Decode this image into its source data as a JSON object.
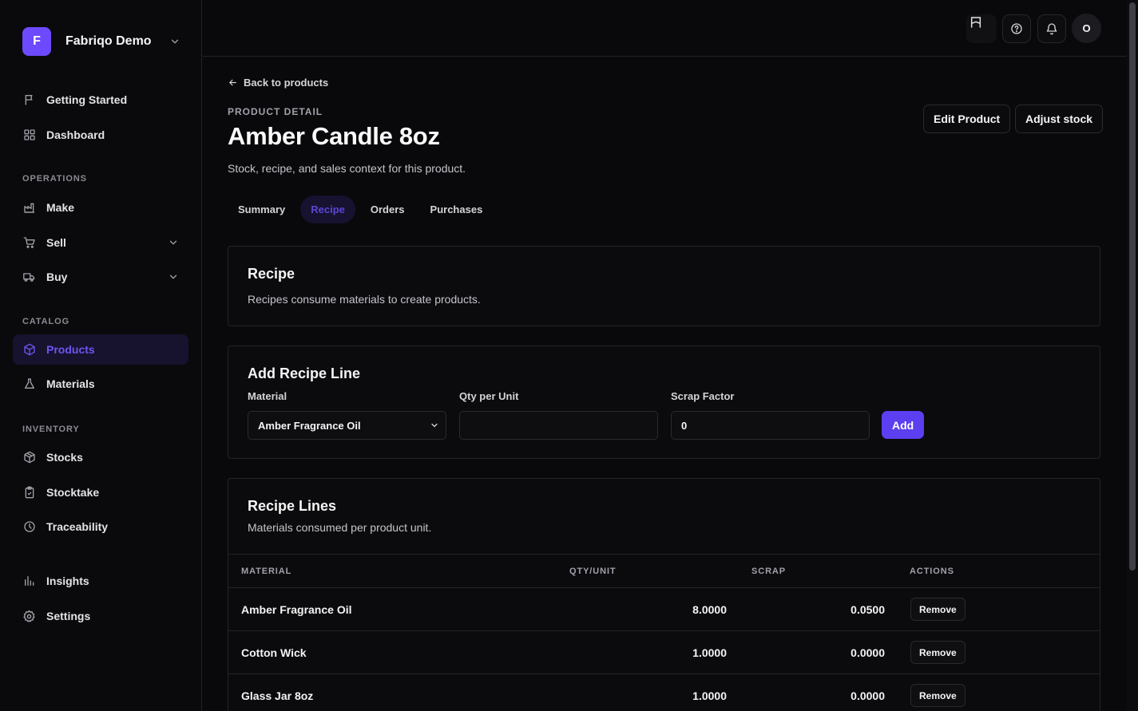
{
  "workspace": {
    "initial": "F",
    "name": "Fabriqo Demo"
  },
  "sidebar": {
    "top_items": [
      {
        "label": "Getting Started",
        "icon": "flag-icon"
      },
      {
        "label": "Dashboard",
        "icon": "dashboard-grid-icon"
      }
    ],
    "sections": {
      "operations": "OPERATIONS",
      "catalog": "CATALOG",
      "inventory": "INVENTORY"
    },
    "operations_items": [
      {
        "label": "Make",
        "icon": "factory-icon"
      },
      {
        "label": "Sell",
        "icon": "cart-icon",
        "expandable": true
      },
      {
        "label": "Buy",
        "icon": "truck-icon",
        "expandable": true
      }
    ],
    "catalog_items": [
      {
        "label": "Products",
        "icon": "box-icon",
        "active": true
      },
      {
        "label": "Materials",
        "icon": "flask-icon"
      }
    ],
    "inventory_items": [
      {
        "label": "Stocks",
        "icon": "package-icon"
      },
      {
        "label": "Stocktake",
        "icon": "clipboard-icon"
      },
      {
        "label": "Traceability",
        "icon": "clock-icon"
      }
    ],
    "bottom_items": [
      {
        "label": "Insights",
        "icon": "bar-chart-icon"
      },
      {
        "label": "Settings",
        "icon": "gear-icon"
      }
    ]
  },
  "topbar": {
    "avatar_initial": "O"
  },
  "page": {
    "back_label": "Back to products",
    "eyebrow": "PRODUCT DETAIL",
    "title": "Amber Candle 8oz",
    "subtitle": "Stock, recipe, and sales context for this product.",
    "edit_label": "Edit Product",
    "adjust_label": "Adjust stock",
    "tabs": [
      {
        "label": "Summary"
      },
      {
        "label": "Recipe",
        "active": true
      },
      {
        "label": "Orders"
      },
      {
        "label": "Purchases"
      }
    ]
  },
  "recipe_card": {
    "title": "Recipe",
    "subtitle": "Recipes consume materials to create products."
  },
  "add_line": {
    "title": "Add Recipe Line",
    "material_label": "Material",
    "material_value": "Amber Fragrance Oil",
    "qty_label": "Qty per Unit",
    "qty_value": "",
    "scrap_label": "Scrap Factor",
    "scrap_value": "0",
    "add_label": "Add"
  },
  "recipe_lines": {
    "title": "Recipe Lines",
    "subtitle": "Materials consumed per product unit.",
    "columns": [
      "MATERIAL",
      "QTY/UNIT",
      "SCRAP",
      "ACTIONS"
    ],
    "rows": [
      {
        "material": "Amber Fragrance Oil",
        "qty": "8.0000",
        "scrap": "0.0500",
        "action": "Remove"
      },
      {
        "material": "Cotton Wick",
        "qty": "1.0000",
        "scrap": "0.0000",
        "action": "Remove"
      },
      {
        "material": "Glass Jar 8oz",
        "qty": "1.0000",
        "scrap": "0.0000",
        "action": "Remove"
      }
    ]
  },
  "colors": {
    "accent": "#5b3ff0",
    "background": "#09090b",
    "active_nav": "#6d56f0"
  }
}
